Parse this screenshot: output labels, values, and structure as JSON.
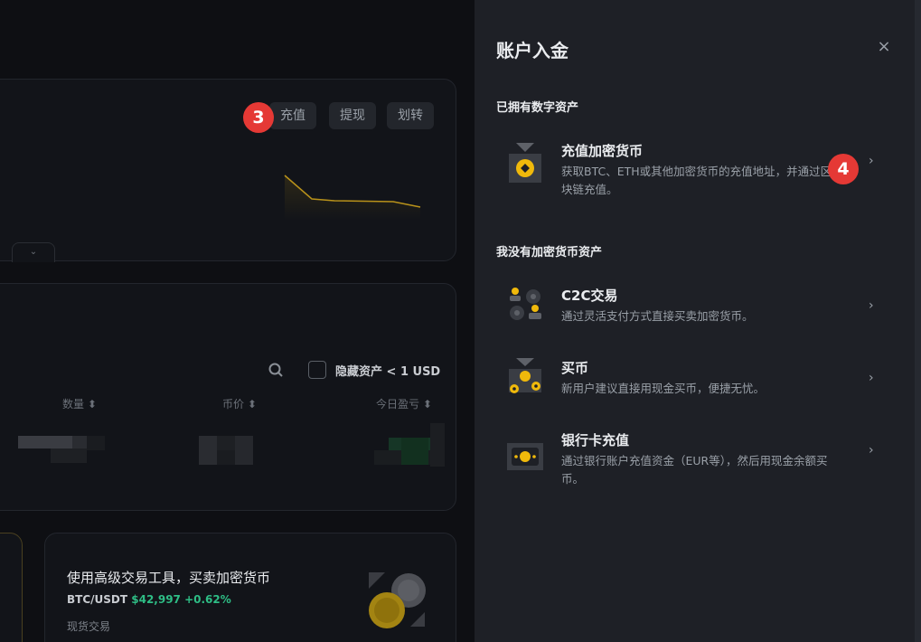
{
  "background": {
    "actions": {
      "deposit": "充值",
      "withdraw": "提现",
      "transfer": "划转"
    },
    "filter": {
      "hide_small": "隐藏资产 < 1 USD"
    },
    "columns": {
      "amount": "数量 ⬍",
      "price": "币价 ⬍",
      "pnl": "今日盈亏 ⬍"
    },
    "promo": {
      "title": "使用高级交易工具，买卖加密货币",
      "pair": "BTC/USDT",
      "price_change": "$42,997 +0.62%",
      "subtitle": "现货交易"
    }
  },
  "badges": {
    "step3": "3",
    "step4": "4"
  },
  "drawer": {
    "title": "账户入金",
    "close": "×",
    "section_have": "已拥有数字资产",
    "section_none": "我没有加密货币资产",
    "options": [
      {
        "title": "充值加密货币",
        "desc": "获取BTC、ETH或其他加密货币的充值地址，并通过区块链充值。",
        "icon": "crypto-deposit-icon"
      },
      {
        "title": "C2C交易",
        "desc": "通过灵活支付方式直接买卖加密货币。",
        "icon": "c2c-icon"
      },
      {
        "title": "买币",
        "desc": "新用户建议直接用现金买币，便捷无忧。",
        "icon": "buy-crypto-icon"
      },
      {
        "title": "银行卡充值",
        "desc": "通过银行账户充值资金（EUR等），然后用现金余额买币。",
        "icon": "bank-card-icon"
      }
    ]
  },
  "colors": {
    "accent": "#f0b90b",
    "badge": "#e53935",
    "up": "#2ebd85"
  }
}
